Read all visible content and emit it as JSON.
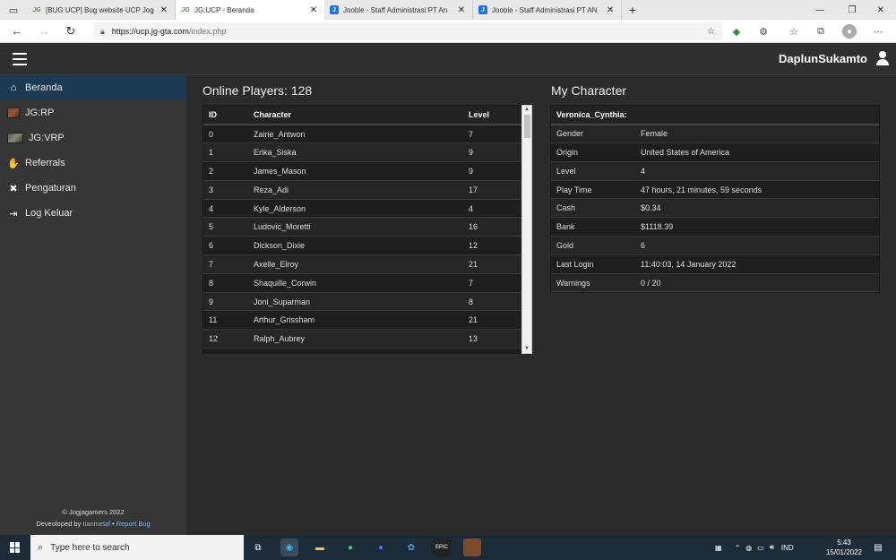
{
  "browser": {
    "tabs": [
      {
        "title": "[BUG UCP] Bug website UCP Jog",
        "favicon": "JG"
      },
      {
        "title": "JG:UCP - Beranda",
        "favicon": "JG"
      },
      {
        "title": "Jooble - Staff Administrasi PT An",
        "favicon": "J"
      },
      {
        "title": "Jooble - Staff Administrasi PT AN",
        "favicon": "J"
      }
    ],
    "url_host": "https://ucp.jg-gta.com",
    "url_path": "/index.php"
  },
  "header": {
    "username": "DaplunSukamto"
  },
  "sidebar": {
    "items": [
      {
        "label": "Beranda",
        "icon": "home-icon"
      },
      {
        "label": "JG:RP",
        "icon": "jgrp-image"
      },
      {
        "label": "JG:VRP",
        "icon": "jgvrp-image"
      },
      {
        "label": "Referrals",
        "icon": "handshake-icon"
      },
      {
        "label": "Pengaturan",
        "icon": "tools-icon"
      },
      {
        "label": "Log Keluar",
        "icon": "sign-out-icon"
      }
    ],
    "footer_copyright": "© Jogjagamers 2022",
    "footer_developed": "Deveoloped by",
    "footer_author": "tianmetal",
    "footer_sep": "•",
    "footer_report": "Report Bug"
  },
  "players": {
    "title": "Online Players: 128",
    "columns": [
      "ID",
      "Character",
      "Level"
    ],
    "rows": [
      [
        "0",
        "Zairie_Antwon",
        "7"
      ],
      [
        "1",
        "Erika_Siska",
        "9"
      ],
      [
        "2",
        "James_Mason",
        "9"
      ],
      [
        "3",
        "Reza_Adi",
        "17"
      ],
      [
        "4",
        "Kyle_Alderson",
        "4"
      ],
      [
        "5",
        "Ludovic_Moretti",
        "16"
      ],
      [
        "6",
        "Dickson_Dixie",
        "12"
      ],
      [
        "7",
        "Axelle_Elroy",
        "21"
      ],
      [
        "8",
        "Shaquille_Corwin",
        "7"
      ],
      [
        "9",
        "Joni_Suparman",
        "8"
      ],
      [
        "11",
        "Arthur_Grissham",
        "21"
      ],
      [
        "12",
        "Ralph_Aubrey",
        "13"
      ]
    ]
  },
  "character": {
    "title": "My Character",
    "name": "Veronica_Cynthia:",
    "rows": [
      [
        "Gender",
        "Female"
      ],
      [
        "Origin",
        "United States of America"
      ],
      [
        "Level",
        "4"
      ],
      [
        "Play Time",
        "47 hours, 21 minutes, 59 seconds"
      ],
      [
        "Cash",
        "$0.34"
      ],
      [
        "Bank",
        "$1118.39"
      ],
      [
        "Gold",
        "6"
      ],
      [
        "Last Login",
        "11:40:03, 14 January 2022"
      ],
      [
        "Warnings",
        "0 / 20"
      ]
    ]
  },
  "taskbar": {
    "search_placeholder": "Type here to search",
    "lang": "IND",
    "time": "5:43",
    "date": "15/01/2022"
  }
}
